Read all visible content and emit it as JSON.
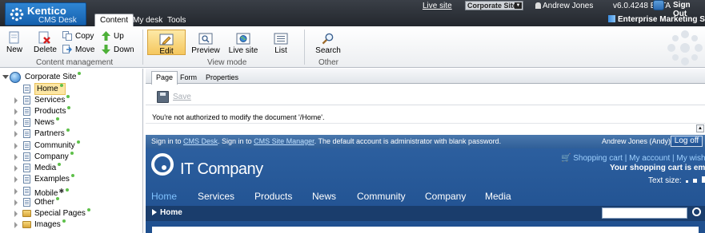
{
  "header": {
    "logo_name": "Kentico",
    "logo_sub": "CMS Desk",
    "tabs": [
      {
        "label": "Content"
      },
      {
        "label": "My desk"
      },
      {
        "label": "Tools"
      }
    ],
    "live_site_link": "Live site",
    "site_selector": "Corporate Site",
    "user": "Andrew Jones",
    "version": "v6.0.4248 BETA",
    "sign_out": "Sign Out",
    "ems": "Enterprise Marketing Solutio"
  },
  "toolbar": {
    "new": "New",
    "delete": "Delete",
    "copy": "Copy",
    "move": "Move",
    "up": "Up",
    "down": "Down",
    "group_content": "Content management",
    "edit": "Edit",
    "preview": "Preview",
    "live_site": "Live site",
    "list": "List",
    "group_view": "View mode",
    "search": "Search",
    "group_other": "Other"
  },
  "tree": {
    "root": "Corporate Site",
    "items": [
      {
        "label": "Home"
      },
      {
        "label": "Services"
      },
      {
        "label": "Products"
      },
      {
        "label": "News"
      },
      {
        "label": "Partners"
      },
      {
        "label": "Community"
      },
      {
        "label": "Company"
      },
      {
        "label": "Media"
      },
      {
        "label": "Examples"
      },
      {
        "label": "Mobile"
      },
      {
        "label": "Other"
      },
      {
        "label": "Special Pages"
      },
      {
        "label": "Images"
      }
    ]
  },
  "editor": {
    "tabs": [
      {
        "label": "Page"
      },
      {
        "label": "Form"
      },
      {
        "label": "Properties"
      }
    ],
    "save": "Save",
    "message": "You're not authorized to modify the document '/Home'."
  },
  "preview": {
    "signin_1": "Sign in to ",
    "signin_cms_desk": "CMS Desk",
    "signin_2": ". Sign in to ",
    "signin_site_manager": "CMS Site Manager",
    "signin_3": ". The default account is administrator with blank password.",
    "who": "Andrew Jones (Andy)",
    "log_off": "Log off",
    "site_title": "IT Company",
    "cart_link": "Shopping cart",
    "sep": " | ",
    "account_link": "My account",
    "wishlist_link": "My wishlist",
    "cart_empty": "Your shopping cart is empty",
    "text_size": "Text size:",
    "nav": [
      {
        "label": "Home"
      },
      {
        "label": "Services"
      },
      {
        "label": "Products"
      },
      {
        "label": "News"
      },
      {
        "label": "Community"
      },
      {
        "label": "Company"
      },
      {
        "label": "Media"
      }
    ],
    "breadcrumb": "Home"
  }
}
